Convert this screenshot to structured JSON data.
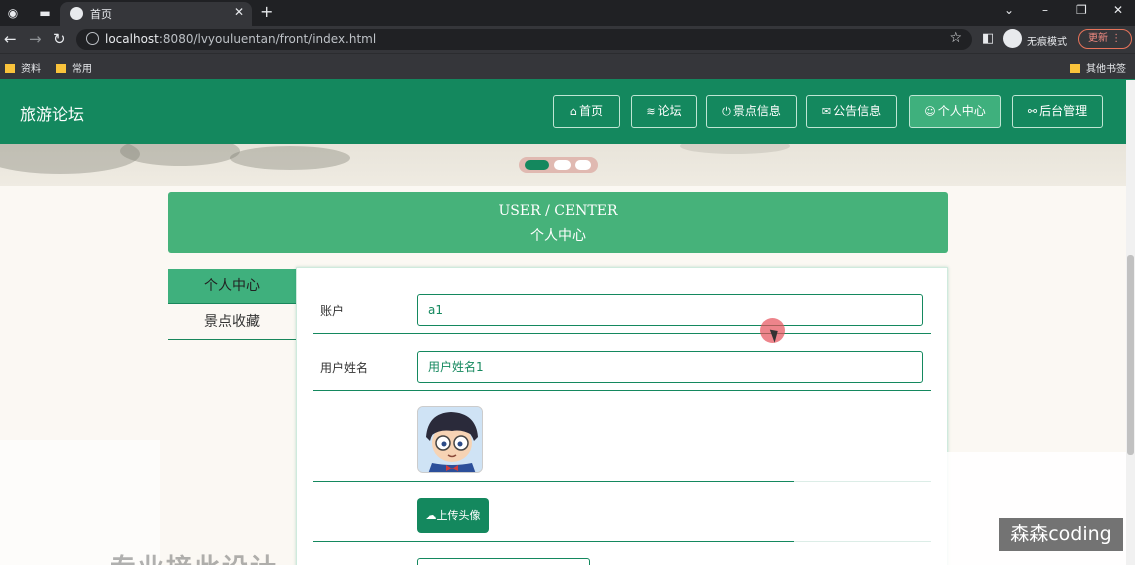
{
  "browser": {
    "tab_title": "首页",
    "url_host": "localhost",
    "url_rest": ":8080/lvyouluentan/front/index.html",
    "incognito_label": "无痕模式",
    "update_label": "更新",
    "bookmarks": [
      "资料",
      "常用"
    ],
    "other_bookmarks": "其他书签"
  },
  "site": {
    "brand": "旅游论坛",
    "nav": [
      {
        "icon": "home-icon",
        "glyph": "⌂",
        "label": "首页"
      },
      {
        "icon": "layers-icon",
        "glyph": "≋",
        "label": "论坛"
      },
      {
        "icon": "power-icon",
        "glyph": "⏻",
        "label": "景点信息"
      },
      {
        "icon": "mail-icon",
        "glyph": "✉",
        "label": "公告信息"
      },
      {
        "icon": "user-icon",
        "glyph": "☺",
        "label": "个人中心"
      },
      {
        "icon": "link-icon",
        "glyph": "⚯",
        "label": "后台管理"
      }
    ],
    "active_nav": 4
  },
  "center": {
    "title_en": "USER / CENTER",
    "title_zh": "个人中心",
    "side_menu": [
      "个人中心",
      "景点收藏"
    ],
    "fields": [
      {
        "label": "账户",
        "value": "a1"
      },
      {
        "label": "用户姓名",
        "value": "用户姓名1"
      }
    ],
    "upload_label": "上传头像"
  },
  "overlay": {
    "watermark": "森森coding",
    "bottom_text": "专业接此设计"
  },
  "colors": {
    "primary": "#14885e",
    "active": "#3fb07d",
    "title_bg": "#46b27a"
  }
}
